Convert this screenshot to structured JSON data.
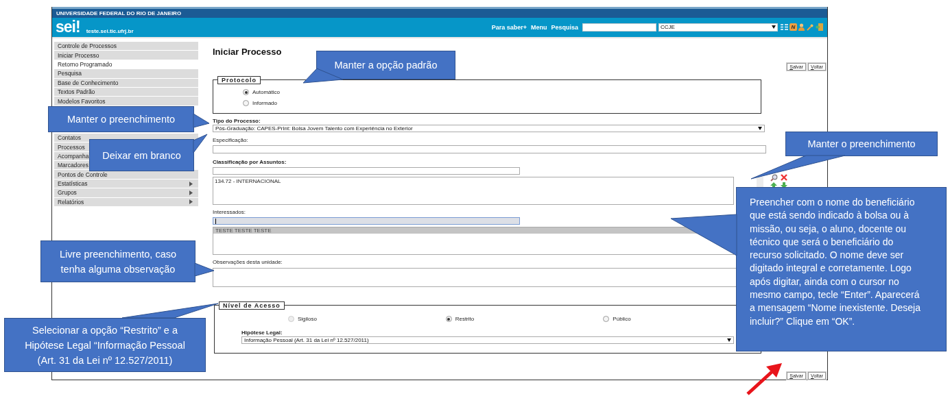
{
  "header": {
    "institution": "UNIVERSIDADE FEDERAL DO RIO DE JANEIRO",
    "logo": "sei!",
    "host": "teste.sei.tic.ufrj.br",
    "links": [
      "Para saber+",
      "Menu",
      "Pesquisa"
    ],
    "unit_select": "CCJE",
    "badge": "N"
  },
  "sidebar": {
    "groups": [
      [
        {
          "label": "Controle de Processos",
          "selected": false,
          "submenu": false
        },
        {
          "label": "Iniciar Processo",
          "selected": false,
          "submenu": false
        },
        {
          "label": "Retorno Programado",
          "selected": true,
          "submenu": false
        },
        {
          "label": "Pesquisa",
          "selected": false,
          "submenu": false
        },
        {
          "label": "Base de Conhecimento",
          "selected": false,
          "submenu": false
        },
        {
          "label": "Textos Padrão",
          "selected": false,
          "submenu": false
        },
        {
          "label": "Modelos Favoritos",
          "selected": false,
          "submenu": false
        }
      ],
      [
        {
          "label": "Contatos",
          "selected": false,
          "submenu": false
        },
        {
          "label": "Processos",
          "selected": false,
          "submenu": false,
          "covered": true
        },
        {
          "label": "Acompanha",
          "selected": false,
          "submenu": false,
          "covered": true
        },
        {
          "label": "Marcadores",
          "selected": false,
          "submenu": false,
          "covered": true
        },
        {
          "label": "Pontos de Controle",
          "selected": false,
          "submenu": false
        },
        {
          "label": "Estatísticas",
          "selected": false,
          "submenu": true
        },
        {
          "label": "Grupos",
          "selected": false,
          "submenu": true
        },
        {
          "label": "Relatórios",
          "selected": false,
          "submenu": true
        }
      ]
    ]
  },
  "main": {
    "title": "Iniciar Processo",
    "top_buttons": [
      "Salvar",
      "Voltar"
    ],
    "protocolo": {
      "legend": "Protocolo",
      "options": [
        {
          "label": "Automático",
          "selected": true
        },
        {
          "label": "Informado",
          "selected": false
        }
      ]
    },
    "tipo": {
      "label": "Tipo do Processo:",
      "value": "Pós-Graduação: CAPES-PrInt: Bolsa Jovem Talento com Experiência no Exterior"
    },
    "especificacao": {
      "label": "Especificação:"
    },
    "classificacao": {
      "label": "Classificação por Assuntos:",
      "items": [
        "134.72 - INTERNACIONAL"
      ]
    },
    "interessados": {
      "label": "Interessados:",
      "focused": true,
      "items": [
        "TESTE TESTE TESTE"
      ]
    },
    "observacoes": {
      "label": "Observações desta unidade:"
    },
    "nivel": {
      "legend": "Nível de Acesso",
      "options": [
        {
          "label": "Sigiloso",
          "selected": false,
          "disabled": true
        },
        {
          "label": "Restrito",
          "selected": true,
          "disabled": false
        },
        {
          "label": "Público",
          "selected": false,
          "disabled": false
        }
      ],
      "hipotese_label": "Hipótese Legal:",
      "hipotese_value": "Informação Pessoal (Art. 31 da Lei nº 12.527/2011)"
    },
    "bottom_buttons": [
      "Salvar",
      "Voltar"
    ]
  },
  "callouts": [
    {
      "text": "Manter a opção padrão"
    },
    {
      "text": "Manter o preenchimento"
    },
    {
      "text": "Deixar em branco"
    },
    {
      "text": "Manter o preenchimento"
    },
    {
      "text": "Livre preenchimento, caso tenha alguma observação"
    },
    {
      "text": "Selecionar a opção “Restrito” e a Hipótese Legal “Informação Pessoal (Art. 31 da Lei nº 12.527/2011)"
    },
    {
      "text": "Preencher com o nome do beneficiário que está sendo indicado à bolsa ou à missão, ou seja, o aluno, docente ou técnico que será o beneficiário do recurso solicitado. O nome deve ser digitado integral e corretamente. Logo após digitar, ainda com o cursor no mesmo campo, tecle “Enter”. Aparecerá a mensagem “Nome inexistente. Deseja incluir?” Clique em “OK”."
    }
  ]
}
